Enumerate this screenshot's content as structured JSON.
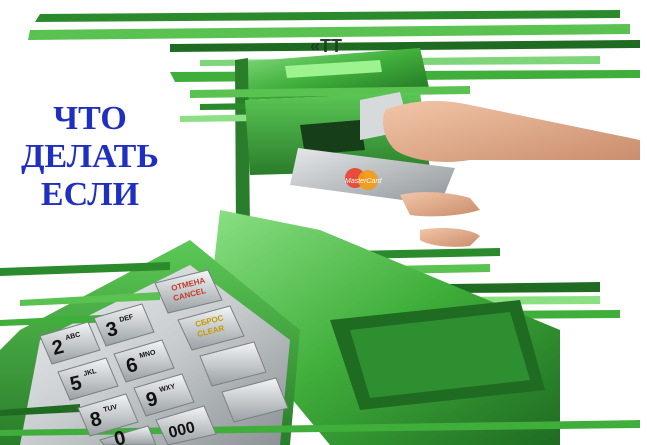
{
  "headline": {
    "line1": "ЧТО",
    "line2": "ДЕЛАТЬ",
    "line3": "ЕСЛИ"
  },
  "atm": {
    "card_slot_logo": "«ТТ",
    "card_brand": "MasterCard",
    "keys": {
      "cancel": {
        "ru": "ОТМЕНА",
        "en": "CANCEL"
      },
      "clear": {
        "ru": "СБРОС",
        "en": "CLEAR"
      },
      "digits": [
        {
          "num": "2",
          "letters": "ABC"
        },
        {
          "num": "3",
          "letters": "DEF"
        },
        {
          "num": "5",
          "letters": "JKL"
        },
        {
          "num": "6",
          "letters": "MNO"
        },
        {
          "num": "8",
          "letters": "TUV"
        },
        {
          "num": "9",
          "letters": "WXY"
        },
        {
          "num": "0",
          "letters": ""
        },
        {
          "num": "000",
          "letters": ""
        }
      ]
    }
  },
  "colors": {
    "atm_green": "#3fae3a",
    "atm_dark_green": "#1f6b22",
    "atm_light_green": "#7fd67a",
    "headline_blue": "#1f2fbf",
    "keypad_silver": "#c9cdcf",
    "cancel_red": "#c0392b",
    "clear_yellow": "#d4b020"
  }
}
